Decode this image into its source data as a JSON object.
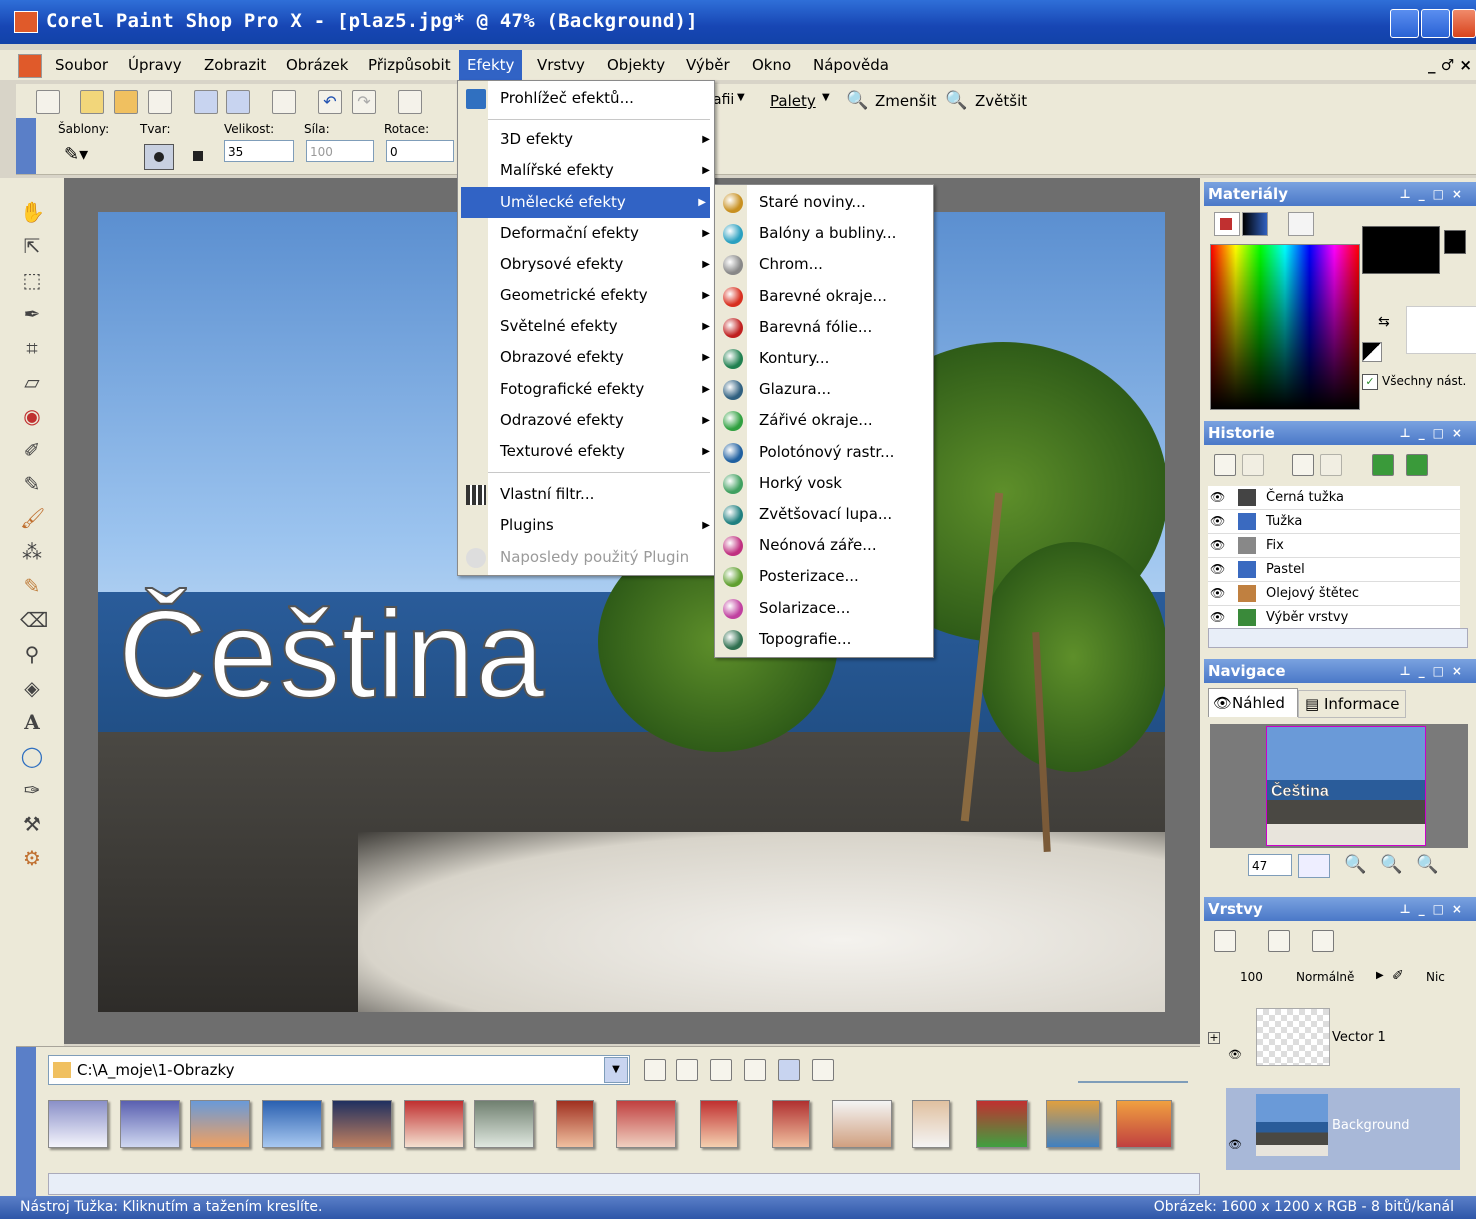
{
  "title": "Corel Paint Shop Pro X - [plaz5.jpg* @  47% (Background)]",
  "menubar": {
    "items": [
      "Soubor",
      "Úpravy",
      "Zobrazit",
      "Obrázek",
      "Přizpůsobit",
      "Efekty",
      "Vrstvy",
      "Objekty",
      "Výběr",
      "Okno",
      "Nápověda"
    ],
    "active": "Efekty",
    "mdi_controls": "_ ♂ ×"
  },
  "toolbar": {
    "palety_label": "Palety",
    "zmensit_label": "Zmenšit",
    "zvetsit_label": "Zvětšit",
    "clipped_label": "afii"
  },
  "tool_options": {
    "sablony_label": "Šablony:",
    "tvar_label": "Tvar:",
    "velikost_label": "Velikost:",
    "velikost_value": "35",
    "sila_label": "Síla:",
    "sila_value": "100",
    "rotace_label": "Rotace:",
    "rotace_value": "0"
  },
  "canvas_text": "Čeština",
  "effects_menu": {
    "items": [
      {
        "label": "Prohlížeč efektů...",
        "icon": "effect-browser-icon",
        "submenu": false
      },
      {
        "label": "3D efekty",
        "submenu": true
      },
      {
        "label": "Malířské efekty",
        "submenu": true
      },
      {
        "label": "Umělecké efekty",
        "submenu": true,
        "highlighted": true
      },
      {
        "label": "Deformační efekty",
        "submenu": true
      },
      {
        "label": "Obrysové efekty",
        "submenu": true
      },
      {
        "label": "Geometrické efekty",
        "submenu": true
      },
      {
        "label": "Světelné efekty",
        "submenu": true
      },
      {
        "label": "Obrazové efekty",
        "submenu": true
      },
      {
        "label": "Fotografické efekty",
        "submenu": true
      },
      {
        "label": "Odrazové efekty",
        "submenu": true
      },
      {
        "label": "Texturové efekty",
        "submenu": true
      },
      {
        "label": "Vlastní filtr...",
        "icon": "custom-filter-icon",
        "submenu": false
      },
      {
        "label": "Plugins",
        "submenu": true
      },
      {
        "label": "Naposledy použitý Plugin",
        "disabled": true
      }
    ]
  },
  "artistic_submenu": {
    "items": [
      {
        "label": "Staré noviny...",
        "color": "#c89020"
      },
      {
        "label": "Balóny a bubliny...",
        "color": "#2aa0c0"
      },
      {
        "label": "Chrom...",
        "color": "#888888"
      },
      {
        "label": "Barevné okraje...",
        "color": "#d83020"
      },
      {
        "label": "Barevná fólie...",
        "color": "#c02020"
      },
      {
        "label": "Kontury...",
        "color": "#208050"
      },
      {
        "label": "Glazura...",
        "color": "#306080"
      },
      {
        "label": "Zářivé okraje...",
        "color": "#30a040"
      },
      {
        "label": "Polotónový rastr...",
        "color": "#2060a0"
      },
      {
        "label": "Horký vosk",
        "color": "#40a060"
      },
      {
        "label": "Zvětšovací lupa...",
        "color": "#208080"
      },
      {
        "label": "Neónová záře...",
        "color": "#c03080"
      },
      {
        "label": "Posterizace...",
        "color": "#60a030"
      },
      {
        "label": "Solarizace...",
        "color": "#c040a0"
      },
      {
        "label": "Topografie...",
        "color": "#307050"
      }
    ]
  },
  "materials": {
    "title": "Materiály",
    "all_tools_label": "Všechny nást."
  },
  "history": {
    "title": "Historie",
    "rows": [
      "Černá tužka",
      "Tužka",
      "Fix",
      "Pastel",
      "Olejový štětec",
      "Výběr vrstvy"
    ]
  },
  "navigation": {
    "title": "Navigace",
    "tab_preview": "Náhled",
    "tab_info": "Informace",
    "zoom_value": "47",
    "preview_text": "Čeština"
  },
  "layers": {
    "title": "Vrstvy",
    "opacity": "100",
    "blend_mode": "Normálně",
    "mask_label": "Nic",
    "items": [
      {
        "name": "Vector 1"
      },
      {
        "name": "Background",
        "selected": true
      }
    ]
  },
  "browser": {
    "path": "C:\\A_moje\\1-Obrazky"
  },
  "status": {
    "left": "Nástroj Tužka: Kliknutím a tažením kreslíte.",
    "right": "Obrázek:  1600 x 1200 x RGB - 8 bitů/kanál"
  },
  "colors": {
    "title_bar": "#1746b4",
    "menu_highlight": "#3163c5",
    "panel_title": "#4a78c8"
  }
}
